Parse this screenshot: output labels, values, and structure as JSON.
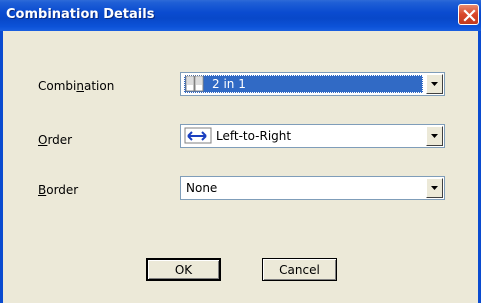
{
  "window": {
    "title": "Combination Details"
  },
  "fields": {
    "combination": {
      "label_pre": "Combi",
      "label_u": "n",
      "label_post": "ation",
      "value": "2 in 1",
      "icon": "pages-icon"
    },
    "order": {
      "label_pre": "",
      "label_u": "O",
      "label_post": "rder",
      "value": "Left-to-Right",
      "icon": "left-to-right-arrow-icon"
    },
    "border": {
      "label_pre": "",
      "label_u": "B",
      "label_post": "order",
      "value": "None"
    }
  },
  "buttons": {
    "ok": "OK",
    "cancel": "Cancel"
  },
  "colors": {
    "titlebar": "#0a4bd0",
    "selection": "#316ac5",
    "dialog_bg": "#ece9d8",
    "close": "#d9462a"
  }
}
